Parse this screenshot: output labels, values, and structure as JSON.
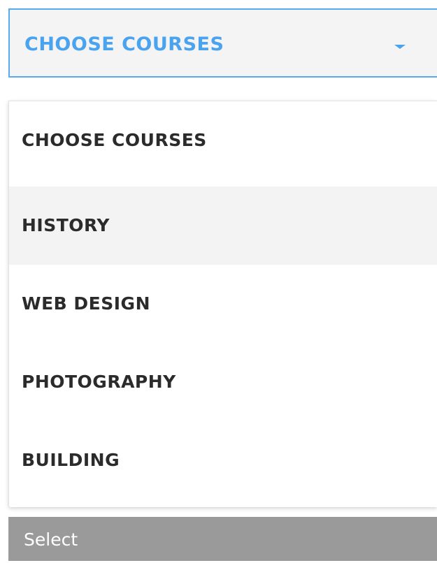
{
  "select": {
    "selected_value": "CHOOSE COURSES",
    "caret_icon": "caret-down-icon",
    "accent_color": "#4aa3ef"
  },
  "dropdown": {
    "options": [
      {
        "label": "CHOOSE COURSES",
        "highlighted": false
      },
      {
        "label": "HISTORY",
        "highlighted": true
      },
      {
        "label": "WEB DESIGN",
        "highlighted": false
      },
      {
        "label": "PHOTOGRAPHY",
        "highlighted": false
      },
      {
        "label": "BUILDING",
        "highlighted": false
      }
    ]
  },
  "footer": {
    "label": "Select"
  }
}
